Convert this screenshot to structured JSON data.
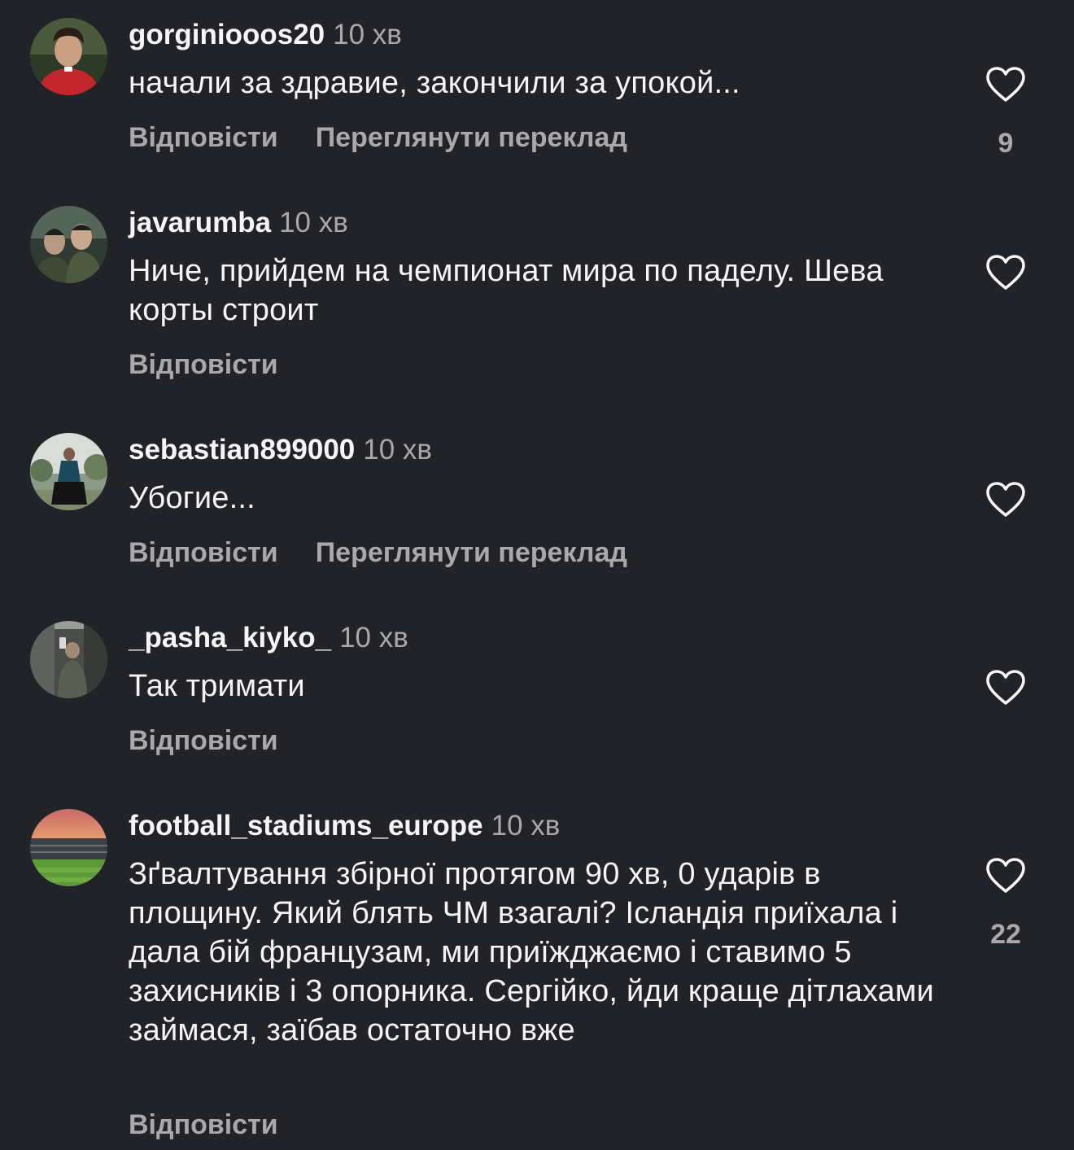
{
  "comments": [
    {
      "username": "gorginiooos20",
      "time": "10 хв",
      "text": "начали за здравие, закончили за упокой...",
      "reply_label": "Відповісти",
      "translate_label": "Переглянути переклад",
      "likes": "9",
      "avatar_icon": "avatar-red-jersey"
    },
    {
      "username": "javarumba",
      "time": "10 хв",
      "text": "Ниче, прийдем на чемпионат мира по паделу. Шева корты строит",
      "reply_label": "Відповісти",
      "avatar_icon": "avatar-two-men"
    },
    {
      "username": "sebastian899000",
      "time": "10 хв",
      "text": "Убогие...",
      "reply_label": "Відповісти",
      "translate_label": "Переглянути переклад",
      "avatar_icon": "avatar-person-outdoors"
    },
    {
      "username": "_pasha_kiyko_",
      "time": "10 хв",
      "text": "Так тримати",
      "reply_label": "Відповісти",
      "avatar_icon": "avatar-elevator-selfie"
    },
    {
      "username": "football_stadiums_europe",
      "time": "10 хв",
      "text": "Зґвалтування збірної протягом 90 хв, 0 ударів в площину. Який блять ЧМ взагалі? Ісландія приїхала і дала бій французам, ми приїжджаємо і ставимо 5 захисників і 3 опорника. Сергійко, йди краще дітлахами займася, заїбав остаточно вже",
      "reply_label": "Відповісти",
      "likes": "22",
      "avatar_icon": "avatar-stadium"
    }
  ],
  "colors": {
    "background": "#212328",
    "primary_text": "#f5f5f5",
    "secondary_text": "#a8a8ad"
  },
  "icons": {
    "like": "heart-outline-icon"
  }
}
